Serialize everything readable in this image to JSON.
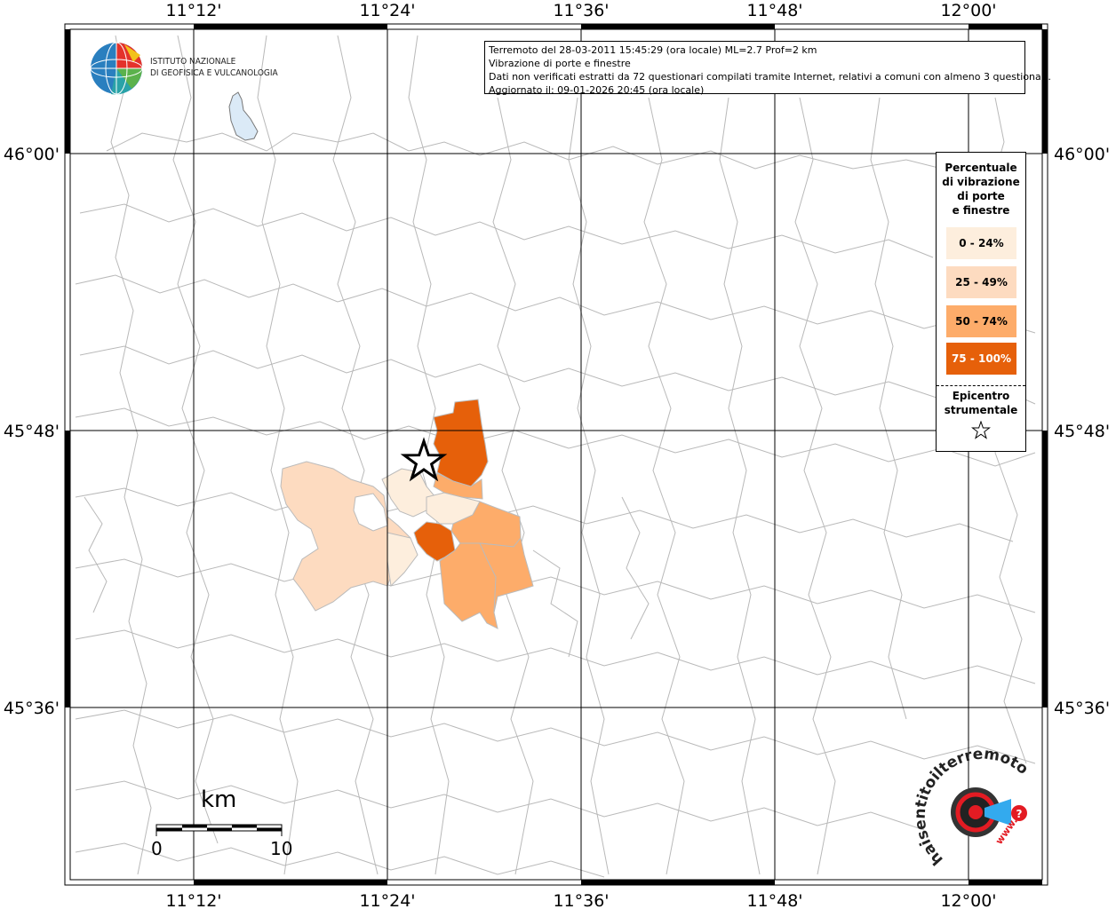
{
  "map": {
    "lon_labels": [
      "11°12'",
      "11°24'",
      "11°36'",
      "11°48'",
      "12°00'"
    ],
    "lat_labels": [
      "46°00'",
      "45°48'",
      "45°36'"
    ]
  },
  "logo": {
    "line1": "ISTITUTO NAZIONALE",
    "line2": "DI GEOFISICA E VULCANOLOGIA"
  },
  "info": {
    "line1": "Terremoto del 28-03-2011 15:45:29 (ora locale) ML=2.7 Prof=2 km",
    "line2": "Vibrazione di porte e finestre",
    "line3": "Dati non verificati estratti da 72 questionari compilati tramite Internet, relativi a comuni con almeno 3 questionari.",
    "line4": "Aggiornato il: 09-01-2026 20:45 (ora locale)"
  },
  "legend": {
    "title_lines": [
      "Percentuale",
      "di vibrazione",
      "di porte",
      "e finestre"
    ],
    "classes": [
      {
        "label": "0 - 24%",
        "color": "#fdeedd"
      },
      {
        "label": "25 - 49%",
        "color": "#fddbc0"
      },
      {
        "label": "50 - 74%",
        "color": "#fdac6a"
      },
      {
        "label": "75 - 100%",
        "color": "#e6600a"
      }
    ],
    "epicenter_lines": [
      "Epicentro",
      "strumentale"
    ]
  },
  "scale": {
    "unit": "km",
    "min": "0",
    "max": "10"
  },
  "watermark": {
    "text": "haisentitoilterremoto.it",
    "url_text": "www."
  }
}
